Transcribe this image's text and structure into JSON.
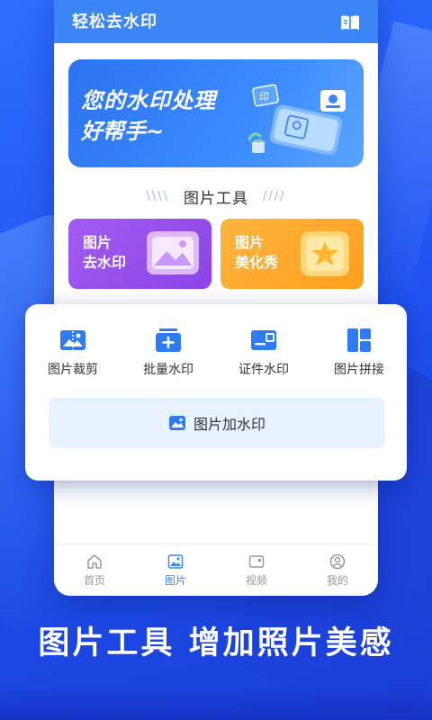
{
  "app_bar": {
    "title": "轻松去水印",
    "icon": "book-icon"
  },
  "banner": {
    "line1": "您的水印处理",
    "line2": "好帮手~",
    "stamp": "印"
  },
  "section": {
    "title": "图片工具",
    "decor_left": "\\\\\\\\",
    "decor_right": "////"
  },
  "features": [
    {
      "line1": "图片",
      "line2": "去水印",
      "color": "#9b52ee"
    },
    {
      "line1": "图片",
      "line2": "美化秀",
      "color": "#ffab2e"
    }
  ],
  "tools": [
    {
      "label": "图片裁剪",
      "icon": "crop-image-icon"
    },
    {
      "label": "批量水印",
      "icon": "batch-add-icon"
    },
    {
      "label": "证件水印",
      "icon": "id-card-icon"
    },
    {
      "label": "图片拼接",
      "icon": "grid-layout-icon"
    }
  ],
  "add_watermark": {
    "label": "图片加水印",
    "icon": "image-icon"
  },
  "tabs": [
    {
      "label": "首页",
      "icon": "home-icon",
      "active": false
    },
    {
      "label": "图片",
      "icon": "image-icon",
      "active": true
    },
    {
      "label": "视频",
      "icon": "video-icon",
      "active": false
    },
    {
      "label": "我的",
      "icon": "profile-icon",
      "active": false
    }
  ],
  "slogan": "图片工具 增加照片美感",
  "colors": {
    "primary": "#3a86f7",
    "tool_blue": "#2f7af5",
    "background": "#2556f2"
  }
}
